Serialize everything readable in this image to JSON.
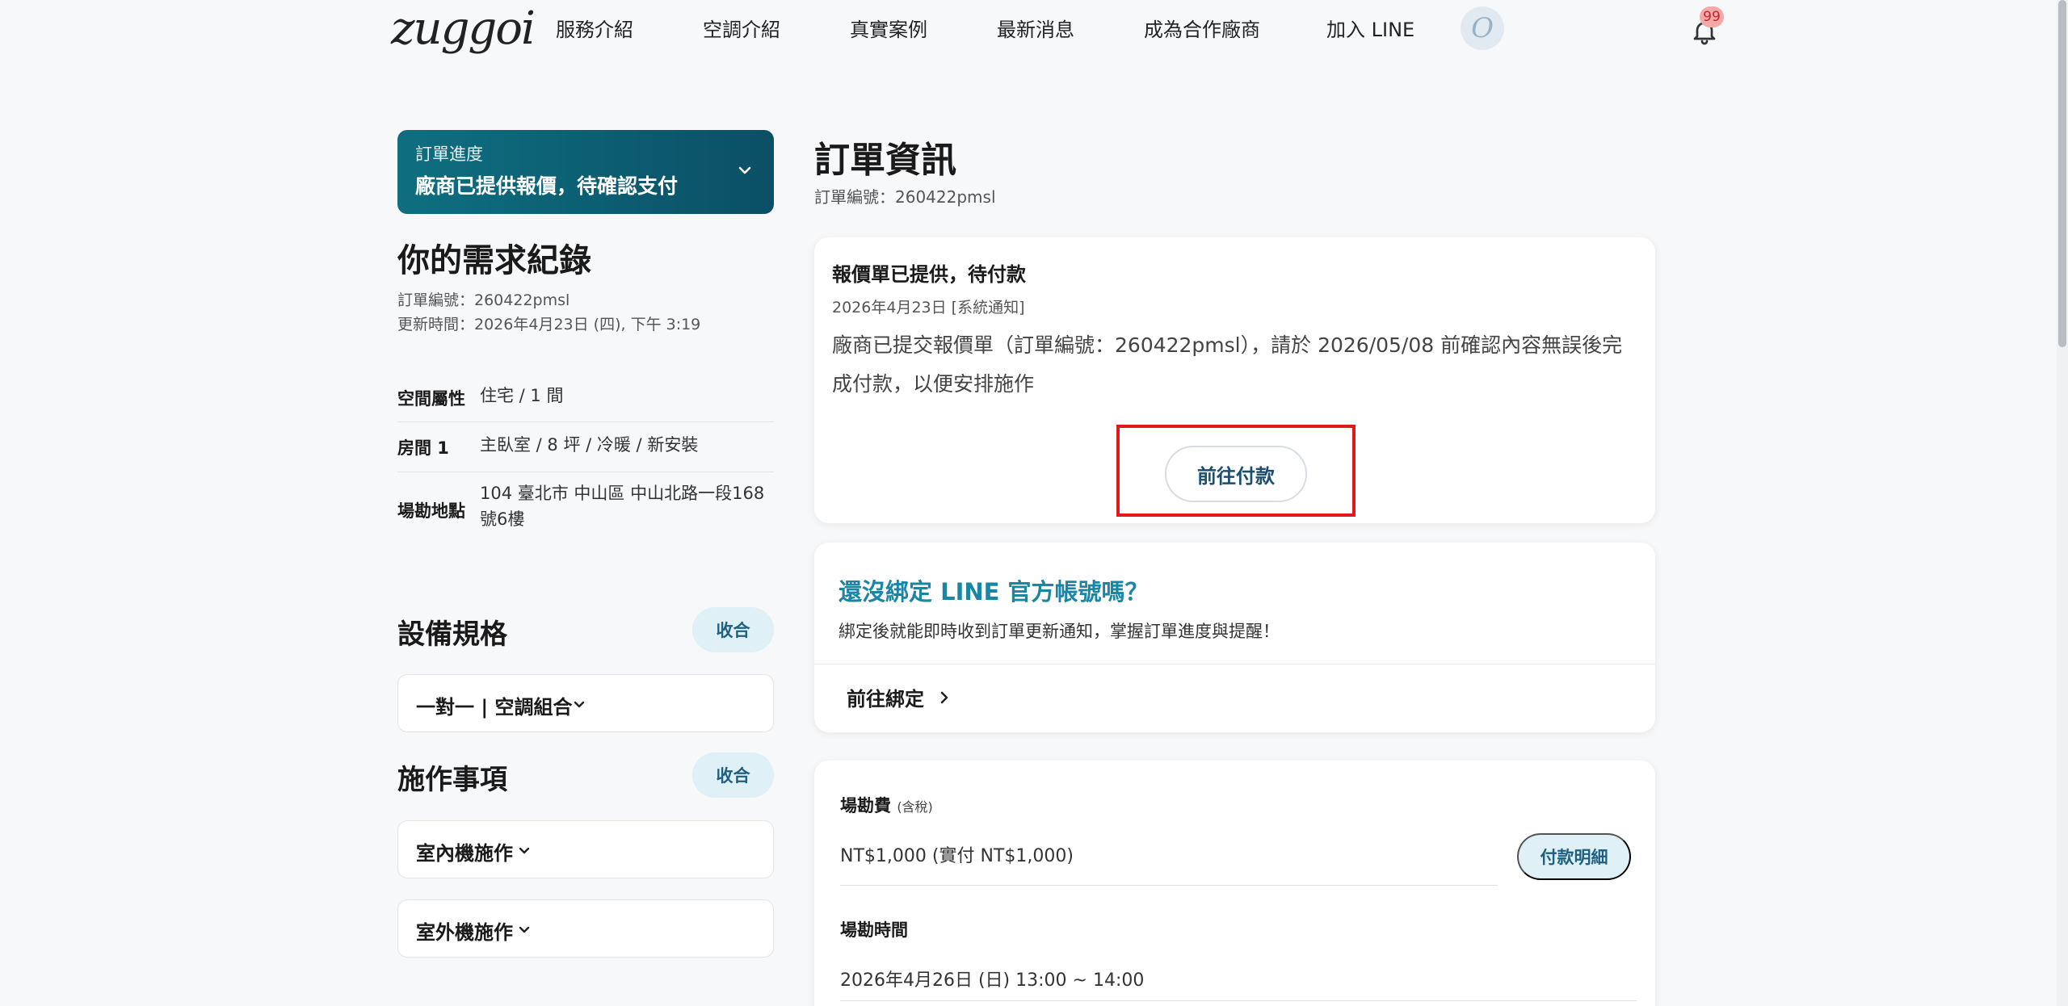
{
  "header": {
    "logo": "zuggoi",
    "nav": [
      "服務介紹",
      "空調介紹",
      "真實案例",
      "最新消息",
      "成為合作廠商",
      "加入 LINE"
    ],
    "avatar_initial": "O",
    "notification_count": "99"
  },
  "sidebar": {
    "progress": {
      "label": "訂單進度",
      "status": "廠商已提供報價，待確認支付"
    },
    "title": "你的需求紀錄",
    "order_no": "訂單編號：260422pmsl",
    "updated": "更新時間：2026年4月23日 (四), 下午 3:19",
    "details": [
      {
        "key": "空間屬性",
        "value": "住宅 / 1 間"
      },
      {
        "key": "房間 1",
        "value": "主臥室 / 8 坪 / 冷暖 / 新安裝"
      },
      {
        "key": "場勘地點",
        "value": "104 臺北市 中山區 中山北路一段168號6樓"
      }
    ],
    "equipment": {
      "title": "設備規格",
      "collapse_label": "收合",
      "option": "一對一 | 空調組合"
    },
    "construction": {
      "title": "施作事項",
      "collapse_label": "收合",
      "options": [
        "室內機施作",
        "室外機施作"
      ]
    }
  },
  "main": {
    "title": "訂單資訊",
    "order_no": "訂單編號：260422pmsl",
    "notice": {
      "title": "報價單已提供，待付款",
      "date": "2026年4月23日 [系統通知]",
      "body": "廠商已提交報價單（訂單編號：260422pmsl），請於 2026/05/08 前確認內容無誤後完成付款，以便安排施作",
      "pay_button": "前往付款"
    },
    "line_card": {
      "title": "還沒綁定 LINE 官方帳號嗎？",
      "subtitle": "綁定後就能即時收到訂單更新通知，掌握訂單進度與提醒！",
      "bind_label": "前往綁定"
    },
    "fee": {
      "survey_fee_label": "場勘費",
      "tax_note": "(含稅)",
      "survey_fee_value": "NT$1,000 (實付 NT$1,000)",
      "detail_button": "付款明細",
      "survey_time_label": "場勘時間",
      "survey_time_value": "2026年4月26日 (日) 13:00 ~ 14:00"
    }
  }
}
